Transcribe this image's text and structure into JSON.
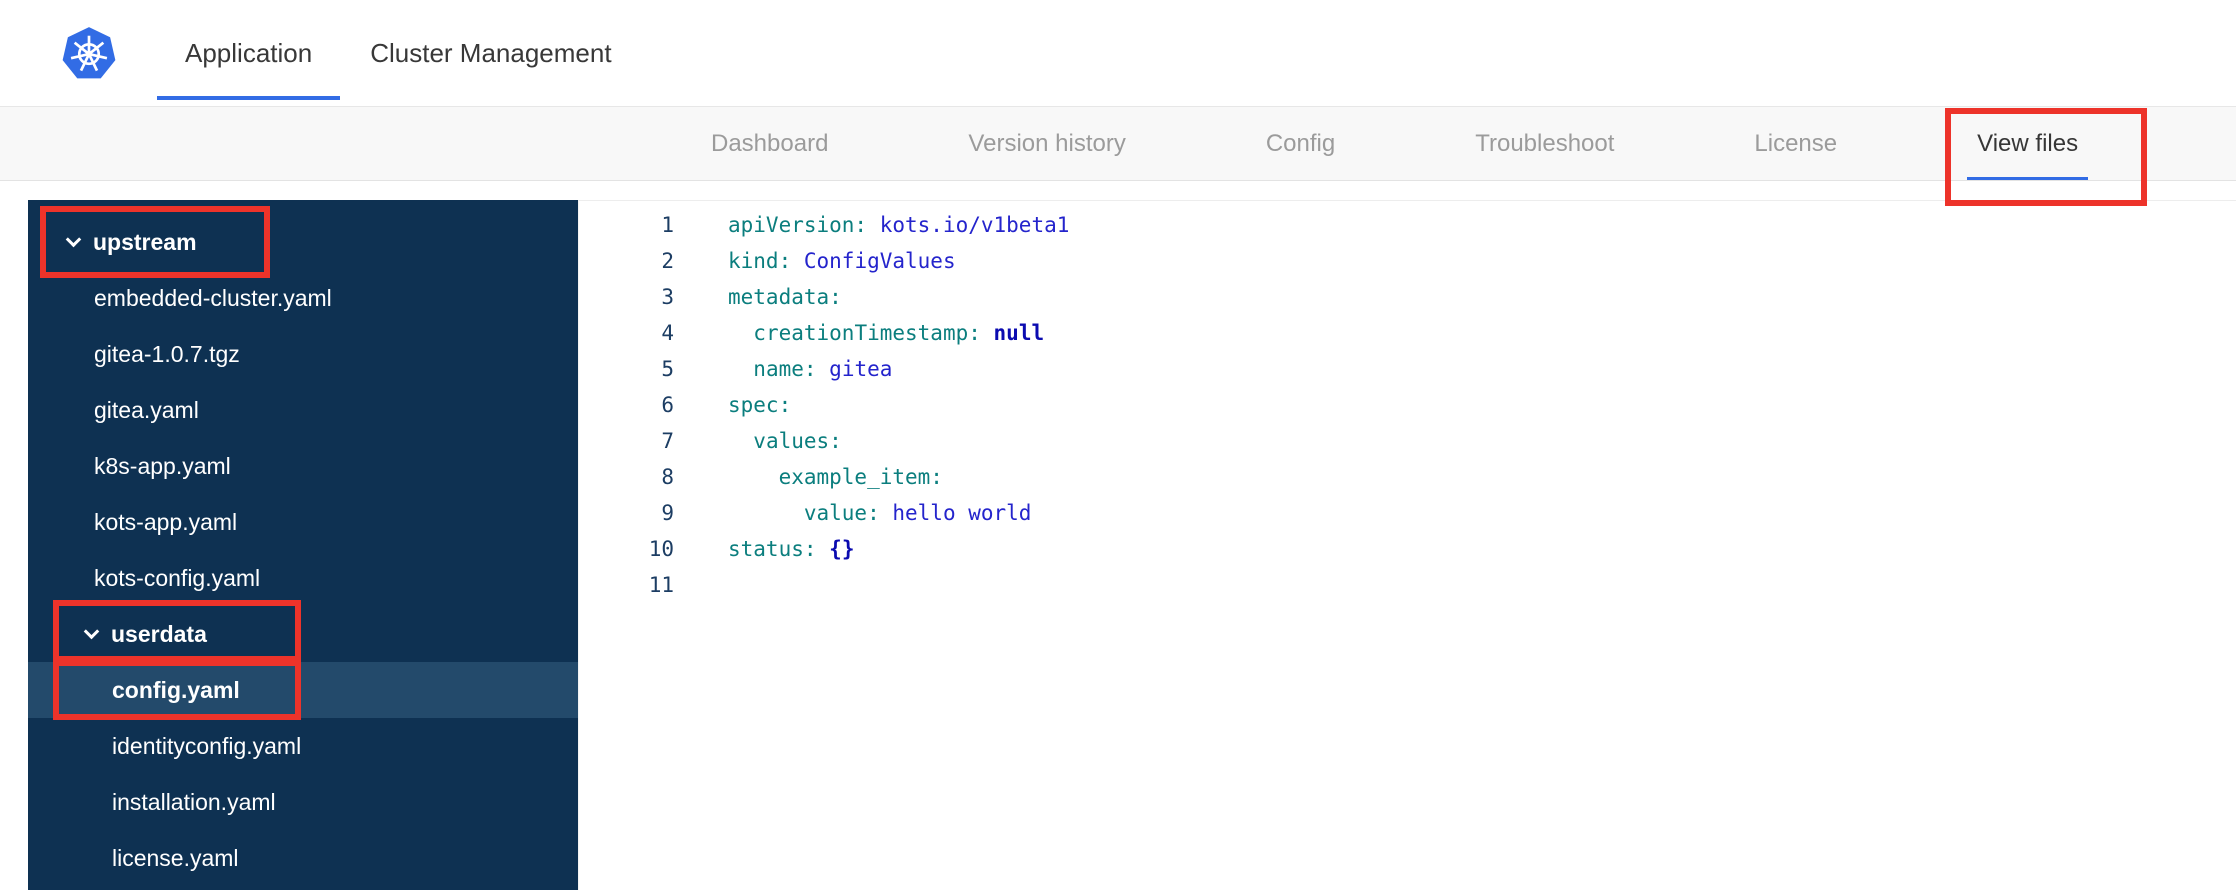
{
  "header": {
    "tabs": [
      {
        "label": "Application",
        "active": true
      },
      {
        "label": "Cluster Management",
        "active": false
      }
    ]
  },
  "subnav": {
    "items": [
      {
        "label": "Dashboard",
        "active": false,
        "annotated": false
      },
      {
        "label": "Version history",
        "active": false,
        "annotated": false
      },
      {
        "label": "Config",
        "active": false,
        "annotated": false
      },
      {
        "label": "Troubleshoot",
        "active": false,
        "annotated": false
      },
      {
        "label": "License",
        "active": false,
        "annotated": false
      },
      {
        "label": "View files",
        "active": true,
        "annotated": true
      }
    ]
  },
  "file_tree": {
    "items": [
      {
        "type": "folder",
        "label": "upstream",
        "depth": 0,
        "expanded": true,
        "selected": false,
        "annotated": true
      },
      {
        "type": "file",
        "label": "embedded-cluster.yaml",
        "depth": 1,
        "selected": false,
        "annotated": false
      },
      {
        "type": "file",
        "label": "gitea-1.0.7.tgz",
        "depth": 1,
        "selected": false,
        "annotated": false
      },
      {
        "type": "file",
        "label": "gitea.yaml",
        "depth": 1,
        "selected": false,
        "annotated": false
      },
      {
        "type": "file",
        "label": "k8s-app.yaml",
        "depth": 1,
        "selected": false,
        "annotated": false
      },
      {
        "type": "file",
        "label": "kots-app.yaml",
        "depth": 1,
        "selected": false,
        "annotated": false
      },
      {
        "type": "file",
        "label": "kots-config.yaml",
        "depth": 1,
        "selected": false,
        "annotated": false
      },
      {
        "type": "folder",
        "label": "userdata",
        "depth": 1,
        "expanded": true,
        "selected": false,
        "annotated": true
      },
      {
        "type": "file",
        "label": "config.yaml",
        "depth": 2,
        "selected": true,
        "annotated": true
      },
      {
        "type": "file",
        "label": "identityconfig.yaml",
        "depth": 2,
        "selected": false,
        "annotated": false
      },
      {
        "type": "file",
        "label": "installation.yaml",
        "depth": 2,
        "selected": false,
        "annotated": false
      },
      {
        "type": "file",
        "label": "license.yaml",
        "depth": 2,
        "selected": false,
        "annotated": false
      }
    ]
  },
  "editor": {
    "language": "yaml",
    "lines": [
      {
        "num": "1",
        "tokens": [
          {
            "type": "key",
            "text": "apiVersion:"
          },
          {
            "type": "plain",
            "text": " "
          },
          {
            "type": "value",
            "text": "kots.io/v1beta1"
          }
        ]
      },
      {
        "num": "2",
        "tokens": [
          {
            "type": "key",
            "text": "kind:"
          },
          {
            "type": "plain",
            "text": " "
          },
          {
            "type": "value",
            "text": "ConfigValues"
          }
        ]
      },
      {
        "num": "3",
        "tokens": [
          {
            "type": "key",
            "text": "metadata:"
          }
        ]
      },
      {
        "num": "4",
        "tokens": [
          {
            "type": "plain",
            "text": "  "
          },
          {
            "type": "key",
            "text": "creationTimestamp:"
          },
          {
            "type": "plain",
            "text": " "
          },
          {
            "type": "atom",
            "text": "null"
          }
        ]
      },
      {
        "num": "5",
        "tokens": [
          {
            "type": "plain",
            "text": "  "
          },
          {
            "type": "key",
            "text": "name:"
          },
          {
            "type": "plain",
            "text": " "
          },
          {
            "type": "value",
            "text": "gitea"
          }
        ]
      },
      {
        "num": "6",
        "tokens": [
          {
            "type": "key",
            "text": "spec:"
          }
        ]
      },
      {
        "num": "7",
        "tokens": [
          {
            "type": "plain",
            "text": "  "
          },
          {
            "type": "key",
            "text": "values:"
          }
        ]
      },
      {
        "num": "8",
        "tokens": [
          {
            "type": "plain",
            "text": "    "
          },
          {
            "type": "key",
            "text": "example_item:"
          }
        ]
      },
      {
        "num": "9",
        "tokens": [
          {
            "type": "plain",
            "text": "      "
          },
          {
            "type": "key",
            "text": "value:"
          },
          {
            "type": "plain",
            "text": " "
          },
          {
            "type": "value",
            "text": "hello world"
          }
        ]
      },
      {
        "num": "10",
        "tokens": [
          {
            "type": "key",
            "text": "status:"
          },
          {
            "type": "plain",
            "text": " "
          },
          {
            "type": "atom",
            "text": "{}"
          }
        ]
      },
      {
        "num": "11",
        "tokens": []
      }
    ]
  },
  "colors": {
    "accent_blue": "#326ce5",
    "annotation_red": "#ed332a",
    "sidebar_bg": "#0e3152",
    "sidebar_selected": "#234a6b",
    "code_key": "#0b7e7e",
    "code_value": "#2424cc",
    "code_atom": "#0b0bb0",
    "line_number": "#1c3d63"
  }
}
